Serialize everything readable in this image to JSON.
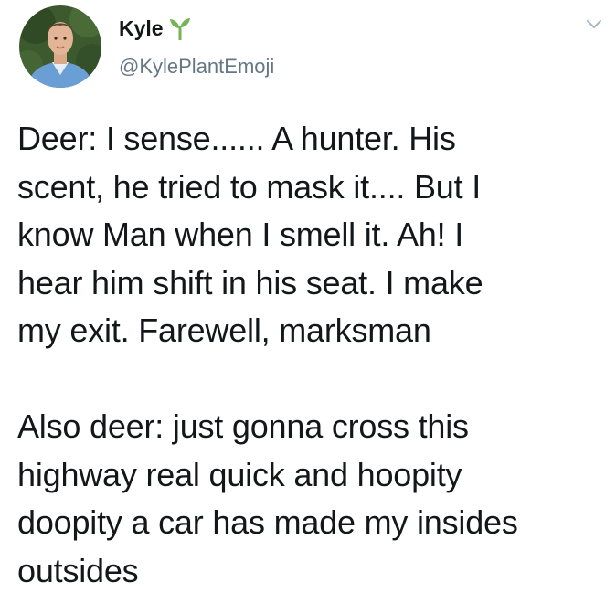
{
  "tweet": {
    "author": {
      "display_name": "Kyle",
      "name_emoji": "seedling-icon",
      "handle": "@KylePlantEmoji",
      "avatar": "avatar-photo"
    },
    "menu_icon": "chevron-down-icon",
    "text": {
      "paragraph_1": "Deer: I sense...... A hunter. His\nscent, he tried to mask it.... But I\nknow Man when I smell it. Ah! I\nhear him shift in his seat. I make\nmy exit. Farewell, marksman",
      "paragraph_2": "Also deer: just gonna cross this\nhighway real quick and hoopity\ndoopity a car has made my insides\noutsides"
    }
  },
  "colors": {
    "text": "#14171a",
    "secondary_text": "#657786",
    "emoji_green": "#77b255",
    "background": "#ffffff"
  }
}
